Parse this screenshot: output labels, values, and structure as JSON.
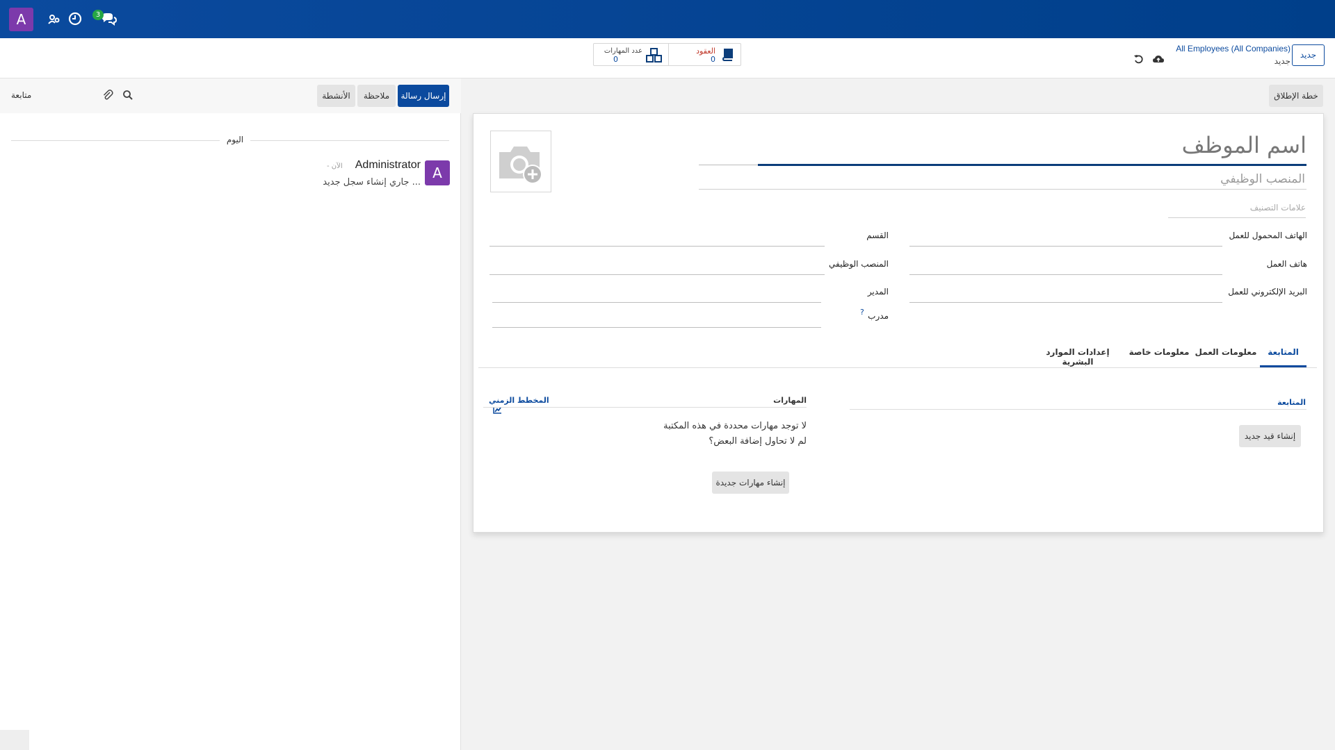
{
  "navbar": {
    "user_initial": "A",
    "messages_count": "3",
    "icons": [
      "chat-icon",
      "clock-icon",
      "users-icon"
    ],
    "color": "#0b4a9e"
  },
  "control_panel": {
    "new_button": "جديد",
    "breadcrumb_parent": "All Employees (All Companies)",
    "breadcrumb_current": "جديد",
    "stats": {
      "contracts_label": "العقود",
      "contracts_value": "0",
      "skills_label": "عدد المهارات",
      "skills_value": "0"
    }
  },
  "chatter": {
    "send_message": "إرسال رسالة",
    "log_note": "ملاحظة",
    "activities": "الأنشطة",
    "follow": "متابعة",
    "today": "اليوم",
    "message": {
      "author_initial": "A",
      "author": "Administrator",
      "time": "- الآن",
      "body": "جاري إنشاء سجل جديد ..."
    }
  },
  "form": {
    "launch_plan": "خطة الإطلاق",
    "name_placeholder": "اسم الموظف",
    "job_title_placeholder": "المنصب الوظيفي",
    "tags_placeholder": "علامات التصنيف",
    "fields_right": [
      {
        "label": "الهاتف المحمول للعمل"
      },
      {
        "label": "هاتف العمل"
      },
      {
        "label": "البريد الإلكتروني للعمل"
      }
    ],
    "fields_left": [
      {
        "label": "القسم"
      },
      {
        "label": "المنصب الوظيفي"
      },
      {
        "label": "المدير"
      },
      {
        "label": "مدرب",
        "help": "?"
      }
    ],
    "tabs": [
      {
        "label": "المتابعة",
        "active": true
      },
      {
        "label": "معلومات العمل",
        "active": false
      },
      {
        "label": "معلومات خاصة",
        "active": false
      },
      {
        "label": "إعدادات الموارد البشرية",
        "active": false
      }
    ],
    "resume": {
      "title": "المتابعة",
      "create_button": "إنشاء قيد جديد"
    },
    "skills": {
      "title": "المهارات",
      "chart_link": "المخطط الزمني",
      "empty_line_1": "لا توجد مهارات محددة في هذه المكتبة",
      "empty_line_2": "لم لا تحاول إضافة البعض؟",
      "create_button": "إنشاء مهارات جديدة"
    }
  }
}
